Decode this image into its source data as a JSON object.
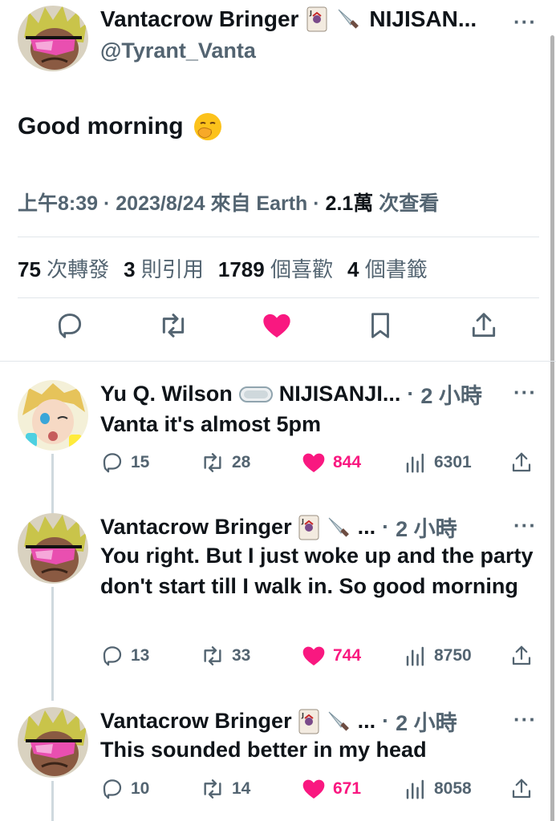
{
  "main_tweet": {
    "display_name": "Vantacrow Bringer",
    "name_suffix": "NIJISAN...",
    "handle": "@Tyrant_Vanta",
    "text": "Good morning",
    "time": "上午8:39",
    "date": "2023/8/24",
    "source": "來自 Earth",
    "views_count": "2.1萬",
    "views_label": "次查看",
    "stats": {
      "retweets": "75",
      "retweets_label": "次轉發",
      "quotes": "3",
      "quotes_label": "則引用",
      "likes": "1789",
      "likes_label": "個喜歡",
      "bookmarks": "4",
      "bookmarks_label": "個書籤"
    },
    "liked": true
  },
  "replies": [
    {
      "display_name": "Yu Q. Wilson",
      "name_suffix": "NIJISANJI...",
      "time": "2 小時",
      "text": "Vanta it's almost 5pm",
      "replies": "15",
      "retweets": "28",
      "likes": "844",
      "views": "6301",
      "liked": true
    },
    {
      "display_name": "Vantacrow Bringer",
      "name_suffix": "...",
      "time": "2 小時",
      "text": "You right. But I just woke up and the party don't start till I walk in. So good morning",
      "replies": "13",
      "retweets": "33",
      "likes": "744",
      "views": "8750",
      "liked": true
    },
    {
      "display_name": "Vantacrow Bringer",
      "name_suffix": "...",
      "time": "2 小時",
      "text": "This sounded better in my head",
      "replies": "10",
      "retweets": "14",
      "likes": "671",
      "views": "8058",
      "liked": true
    }
  ],
  "colors": {
    "like": "#f91880",
    "muted": "#536471",
    "text": "#0f1419",
    "divider": "#e1e6ea"
  }
}
